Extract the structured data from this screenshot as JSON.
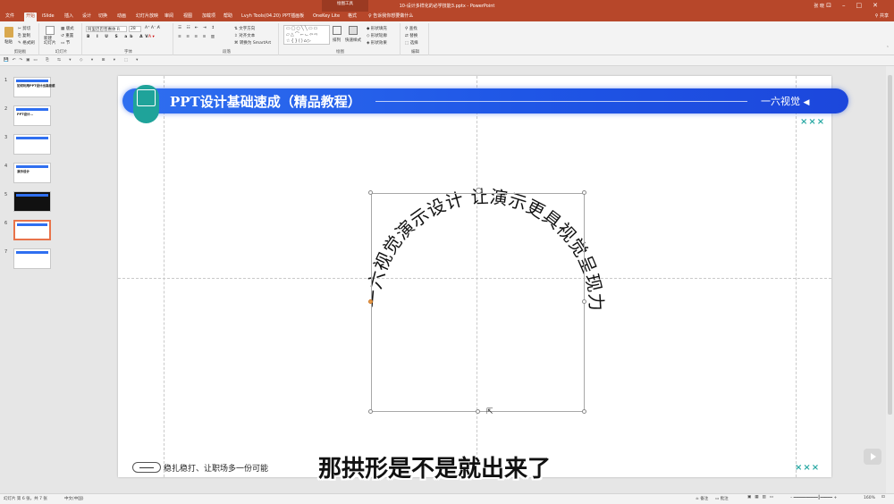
{
  "titlebar": {
    "context": "绘图工具",
    "document": "10-设计多样化的必学技能3.pptx - PowerPoint",
    "user": "张 晓"
  },
  "tabs": [
    "文件",
    "开始",
    "iSlide",
    "插入",
    "设计",
    "切换",
    "动画",
    "幻灯片放映",
    "审阅",
    "视图",
    "加载项",
    "帮助",
    "Lvyh Tools(04.20)",
    "PPT插画板",
    "OneKey Lite",
    "格式"
  ],
  "active_tab": "开始",
  "tellme": "告诉我你想要做什么",
  "share": "共享",
  "ribbon": {
    "clipboard": {
      "label": "剪贴板",
      "paste": "粘贴",
      "cut": "剪切",
      "copy": "复制",
      "format_painter": "格式刷"
    },
    "slides": {
      "label": "幻灯片",
      "new_slide": "新建\n幻灯片",
      "layout": "版式",
      "reset": "重置",
      "section": "节"
    },
    "font": {
      "label": "字体",
      "name": "阿里巴巴普惠体 R",
      "size": "28"
    },
    "paragraph": {
      "label": "段落",
      "text_direction": "文字方向",
      "align_text": "对齐文本",
      "smartart": "转换为 SmartArt"
    },
    "drawing": {
      "label": "绘图",
      "arrange": "排列",
      "quick_styles": "快速样式",
      "fill": "形状填充",
      "outline": "形状轮廓",
      "effects": "形状效果"
    },
    "editing": {
      "label": "编辑",
      "find": "查找",
      "replace": "替换",
      "select": "选择"
    }
  },
  "thumbnails": [
    {
      "num": "1",
      "text": "如何利用PPT设计出高级感"
    },
    {
      "num": "2",
      "text": "PPT设计…"
    },
    {
      "num": "3",
      "text": ""
    },
    {
      "num": "4",
      "text": "演示设计"
    },
    {
      "num": "5",
      "text": ""
    },
    {
      "num": "6",
      "text": ""
    },
    {
      "num": "7",
      "text": ""
    }
  ],
  "slide": {
    "banner_title": "PPT设计基础速成（精品教程）",
    "banner_right": "一六视觉",
    "banner_arrow": "◀",
    "arc_text": "一六视觉演示设计 让演示更具视觉呈现力",
    "marks_top": "×××",
    "marks_bottom": "×××",
    "footer_text": "稳扎稳打、让职场多一份可能"
  },
  "subtitle": "那拱形是不是就出来了",
  "status": {
    "slide_info": "幻灯片 第 6 张，共 7 张",
    "language": "中文(中国)",
    "notes": "备注",
    "comments": "批注",
    "zoom": "160%"
  }
}
